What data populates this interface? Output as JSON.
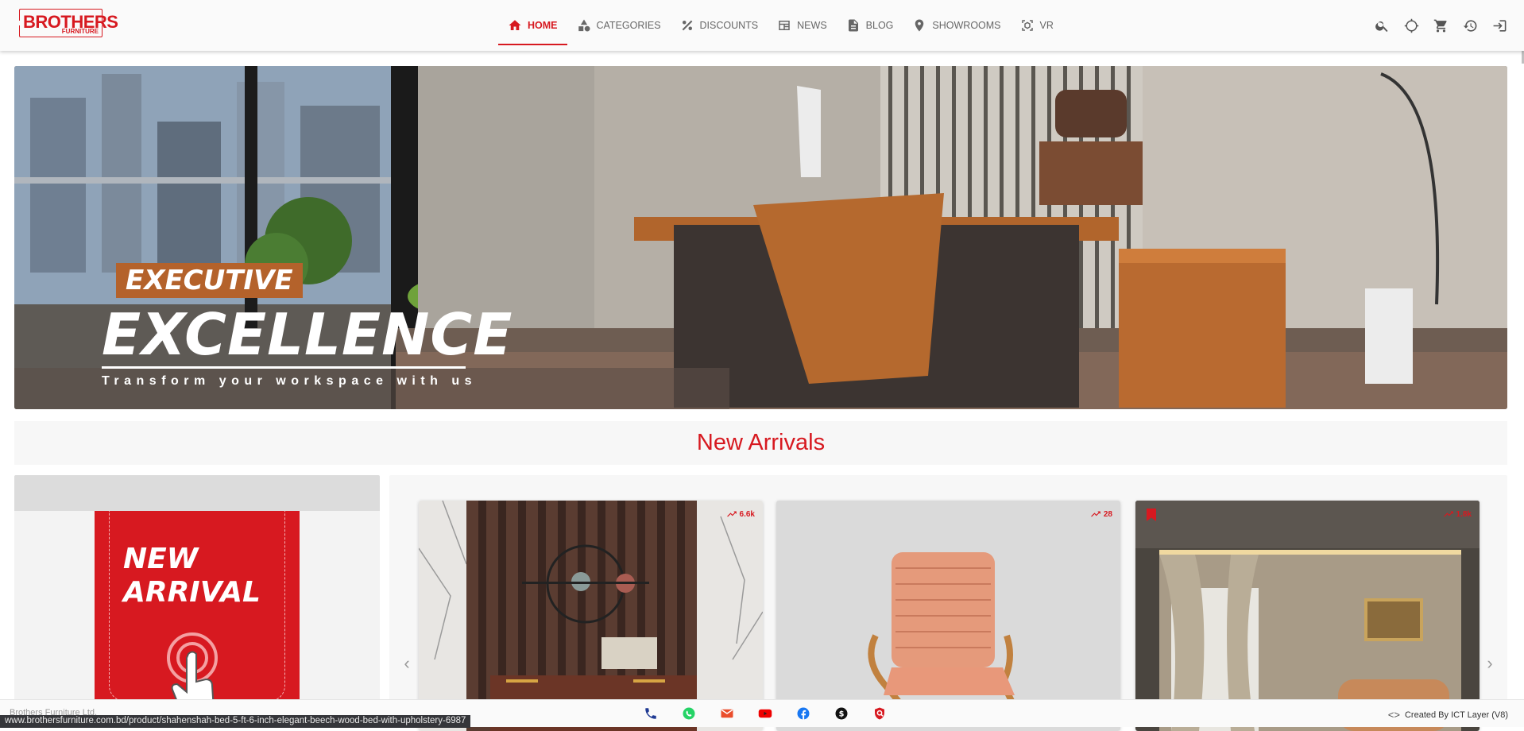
{
  "brand": {
    "name": "BROTHERS",
    "sub": "FURNITURE",
    "color": "#d71920"
  },
  "nav": {
    "items": [
      {
        "label": "HOME",
        "icon": "home-icon",
        "active": true
      },
      {
        "label": "CATEGORIES",
        "icon": "categories-icon",
        "active": false
      },
      {
        "label": "DISCOUNTS",
        "icon": "percent-icon",
        "active": false
      },
      {
        "label": "NEWS",
        "icon": "news-icon",
        "active": false
      },
      {
        "label": "BLOG",
        "icon": "blog-icon",
        "active": false
      },
      {
        "label": "SHOWROOMS",
        "icon": "location-pin-icon",
        "active": false
      },
      {
        "label": "VR",
        "icon": "vr-icon",
        "active": false
      }
    ]
  },
  "header_actions": [
    "search-icon",
    "locate-icon",
    "cart-icon",
    "history-icon",
    "login-icon"
  ],
  "hero": {
    "line1": "EXECUTIVE",
    "line2": "EXCELLENCE",
    "tagline": "Transform your workspace with us"
  },
  "section": {
    "title": "New Arrivals"
  },
  "promo": {
    "line1": "NEW",
    "line2": "ARRIVAL"
  },
  "carousel": {
    "prev": "‹",
    "next": "›",
    "cards": [
      {
        "badge": "6.6k",
        "badge_icon": "trending-up-icon",
        "bookmarked": false
      },
      {
        "badge": "28",
        "badge_icon": "trending-up-icon",
        "bookmarked": false
      },
      {
        "badge": "1.8k",
        "badge_icon": "trending-up-icon",
        "bookmarked": true
      }
    ]
  },
  "footer": {
    "left_text": "Brothers Furniture Ltd.",
    "status_url": "www.brothersfurniture.com.bd/product/shahenshah-bed-5-ft-6-inch-elegant-beech-wood-bed-with-upholstery-6987",
    "social": [
      "phone-icon",
      "whatsapp-icon",
      "email-icon",
      "youtube-icon",
      "facebook-icon",
      "skype-icon",
      "ict-icon"
    ],
    "credit": "Created By ICT Layer (V8)",
    "credit_code": "<>"
  }
}
